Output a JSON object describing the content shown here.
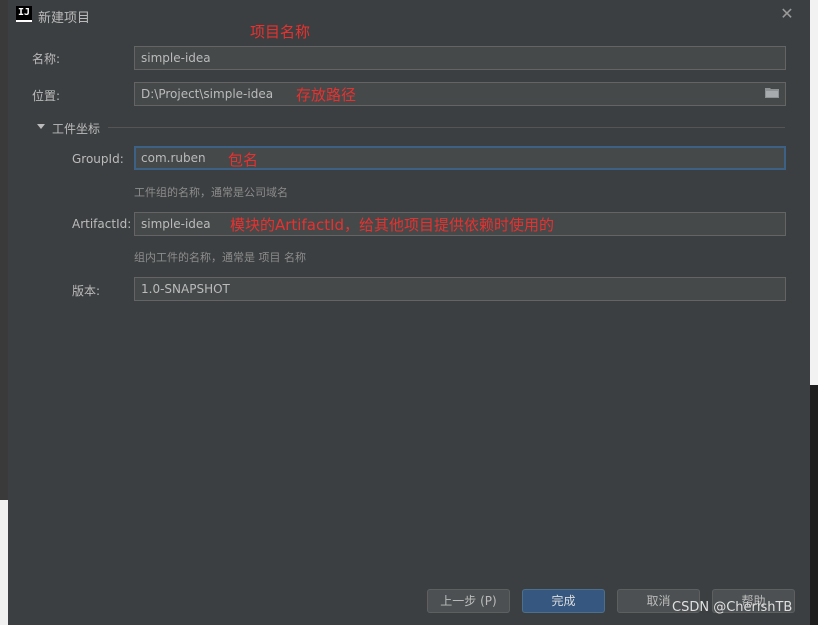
{
  "window": {
    "title": "新建项目"
  },
  "form": {
    "name_label": "名称:",
    "name_value": "simple-idea",
    "location_label": "位置:",
    "location_value": "D:\\Project\\simple-idea",
    "section_title": "工件坐标",
    "groupid_label": "GroupId:",
    "groupid_value": "com.ruben",
    "groupid_hint": "工件组的名称，通常是公司域名",
    "artifactid_label": "ArtifactId:",
    "artifactid_value": "simple-idea",
    "artifactid_hint": "组内工件的名称，通常是 项目 名称",
    "version_label": "版本:",
    "version_value": "1.0-SNAPSHOT"
  },
  "annotations": {
    "project_name": "项目名称",
    "storage_path": "存放路径",
    "package_name": "包名",
    "artifact_note": "模块的ArtifactId，给其他项目提供依赖时使用的"
  },
  "buttons": {
    "previous": "上一步 (P)",
    "finish": "完成",
    "cancel": "取消",
    "help": "帮助"
  },
  "watermark": "CSDN @CherishTB",
  "colors": {
    "accent": "#365880",
    "annotation": "#e8312f",
    "background": "#3c3f41"
  },
  "icons": {
    "app": "intellij-icon",
    "close": "close-icon",
    "folder": "folder-icon",
    "toggle": "chevron-down-icon"
  }
}
